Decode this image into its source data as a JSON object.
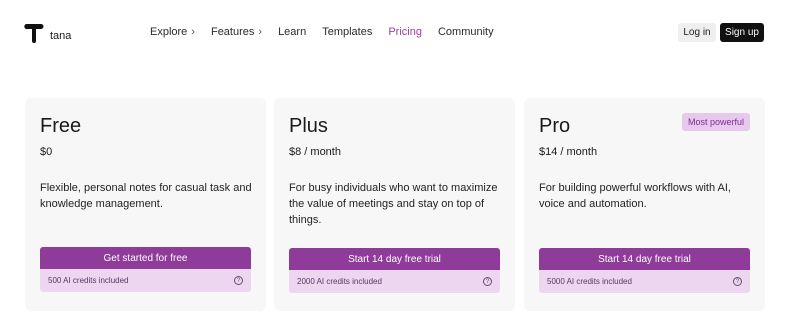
{
  "nav": {
    "logo_text": "tana",
    "links": [
      {
        "label": "Explore",
        "chevron": "›"
      },
      {
        "label": "Features",
        "chevron": "›"
      },
      {
        "label": "Learn"
      },
      {
        "label": "Templates"
      },
      {
        "label": "Pricing"
      },
      {
        "label": "Community"
      }
    ],
    "login_label": "Log in",
    "signup_label": "Sign up"
  },
  "plans": [
    {
      "name": "Free",
      "price": "$0",
      "description": "Flexible, personal notes for casual task and knowledge management.",
      "cta_label": "Get started for free",
      "credits_label": "500 AI credits included"
    },
    {
      "name": "Plus",
      "price": "$8 / month",
      "description": "For busy individuals who want to maximize the value of meetings and stay on top of things.",
      "cta_label": "Start 14 day free trial",
      "credits_label": "2000 AI credits included"
    },
    {
      "name": "Pro",
      "price": "$14 / month",
      "badge": "Most powerful",
      "description": "For building powerful workflows with AI, voice and automation.",
      "cta_label": "Start 14 day free trial",
      "credits_label": "5000 AI credits included"
    }
  ],
  "icons": {
    "help": "?"
  },
  "colors": {
    "accent": "#8f3b99",
    "accent_light": "#ecd6f0",
    "pricing_active": "#9b3fa8",
    "badge_bg": "#e8c9ee"
  }
}
